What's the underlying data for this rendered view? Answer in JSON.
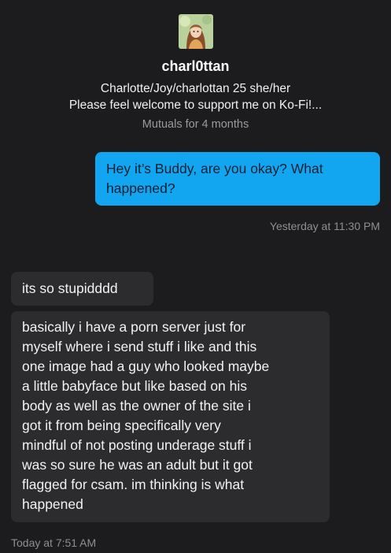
{
  "profile": {
    "avatar_icon": "character-avatar-image",
    "username": "charl0ttan",
    "bio_line_1": "Charlotte/Joy/charlottan 25 she/her",
    "bio_line_2": "Please feel welcome to support me on Ko-Fi!...",
    "mutuals": "Mutuals for 4 months"
  },
  "colors": {
    "background": "#1c1c1e",
    "outgoing_bubble": "#13a6f0",
    "incoming_bubble": "#2c2c2e",
    "timestamp": "#8e8e93"
  },
  "messages": [
    {
      "direction": "outgoing",
      "lines": [
        "Hey it’s Buddy, are you okay? What",
        "happened?"
      ],
      "timestamp": "Yesterday at 11:30 PM"
    },
    {
      "direction": "incoming",
      "lines": [
        "its so stupidddd"
      ]
    },
    {
      "direction": "incoming",
      "lines": [
        "basically i have a porn server just for",
        "myself where i send stuff i like and this",
        "one image had a guy who looked maybe",
        "a little babyface but like based on his",
        "body as well as the owner of the site i",
        "got it from being specifically very",
        "mindful of not posting underage stuff i",
        "was so sure he was an adult but it got",
        "flagged for csam. im thinking is what",
        "happened"
      ],
      "timestamp": "Today at 7:51 AM"
    }
  ]
}
